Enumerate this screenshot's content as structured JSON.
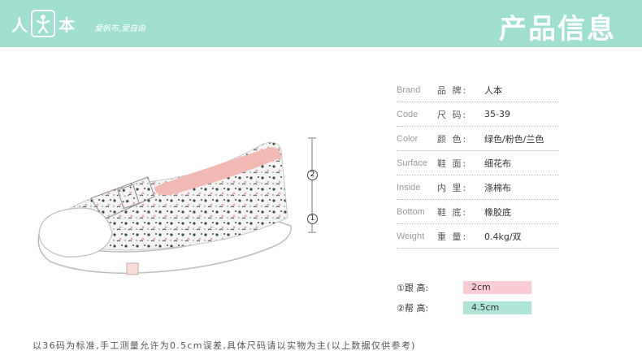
{
  "header": {
    "logo_left": "人",
    "logo_right": "本",
    "slogan": "爱帆布,爱自由",
    "title": "产品信息",
    "bg_color": "#9fdfd0"
  },
  "markers": {
    "upper": "2",
    "lower": "1"
  },
  "specs": [
    {
      "en": "Brand",
      "cn": "品  牌:",
      "value": "人本"
    },
    {
      "en": "Code",
      "cn": "尺  码:",
      "value": "35-39"
    },
    {
      "en": "Color",
      "cn": "颜  色:",
      "value": "绿色/粉色/兰色"
    },
    {
      "en": "Surface",
      "cn": "鞋  面:",
      "value": "细花布"
    },
    {
      "en": "Inside",
      "cn": "内  里:",
      "value": "涤棉布"
    },
    {
      "en": "Bottom",
      "cn": "鞋  底:",
      "value": "橡胶底"
    },
    {
      "en": "Weight",
      "cn": "重  量:",
      "value": "0.4kg/双"
    }
  ],
  "heights": [
    {
      "label": "①跟  高:",
      "value": "2cm",
      "color": "#f9cdd3"
    },
    {
      "label": "②帮  高:",
      "value": "4.5cm",
      "color": "#aee5d8"
    }
  ],
  "footnote": "以36码为标准,手工测量允许为0.5cm误差,具体尺码请以实物为主(以上数据仅供参考)"
}
